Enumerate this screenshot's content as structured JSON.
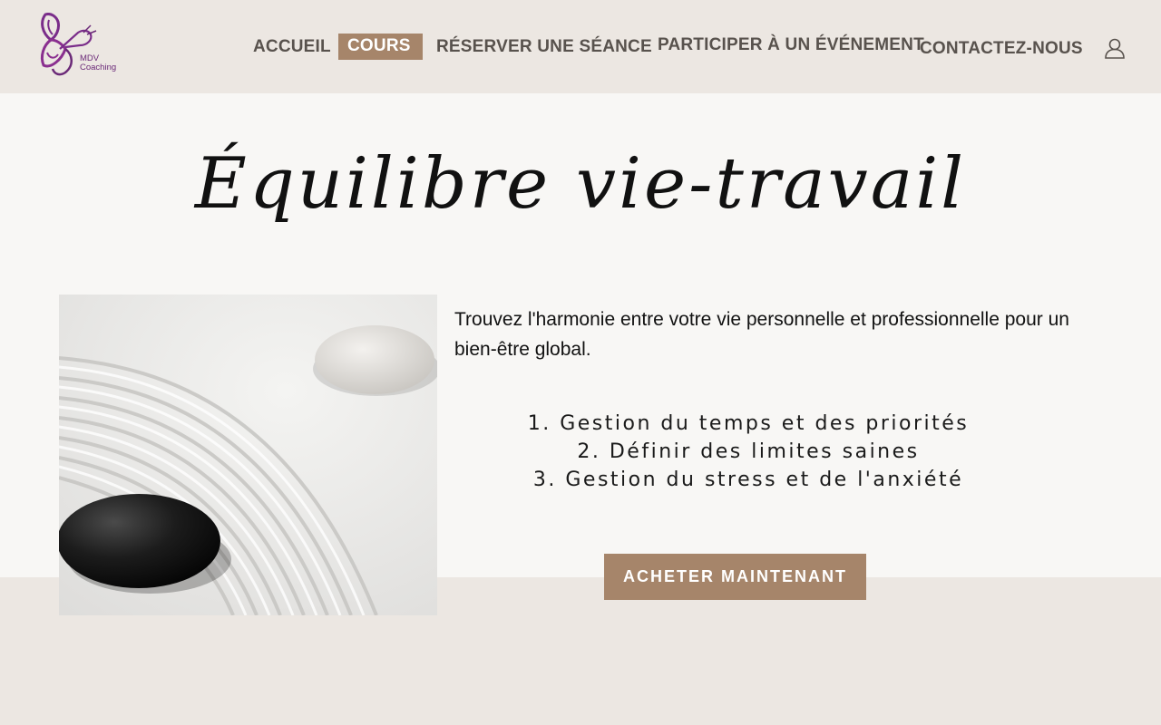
{
  "brand": {
    "logo_line1": "MDV",
    "logo_line2": "Coaching"
  },
  "nav": {
    "items": [
      {
        "label": "ACCUEIL"
      },
      {
        "label": "COURS",
        "active": true
      },
      {
        "label": "RÉSERVER UNE SÉANCE"
      },
      {
        "label": "PARTICIPER À UN ÉVÉNEMENT"
      },
      {
        "label": "CONTACTEZ-NOUS"
      }
    ],
    "user_icon": "user-icon"
  },
  "main": {
    "title": "Équilibre vie-travail",
    "intro": "Trouvez l'harmonie entre votre vie personnelle et professionnelle pour un bien-être global.",
    "steps": [
      "1. Gestion du temps et des priorités",
      "2. Définir des limites saines",
      "3. Gestion du stress et de l'anxiété"
    ],
    "cta_label": "ACHETER MAINTENANT"
  },
  "colors": {
    "background": "#ece7e2",
    "panel": "#f8f7f5",
    "accent": "#a6856a",
    "nav_text": "#58524d",
    "logo": "#6b2a78"
  }
}
